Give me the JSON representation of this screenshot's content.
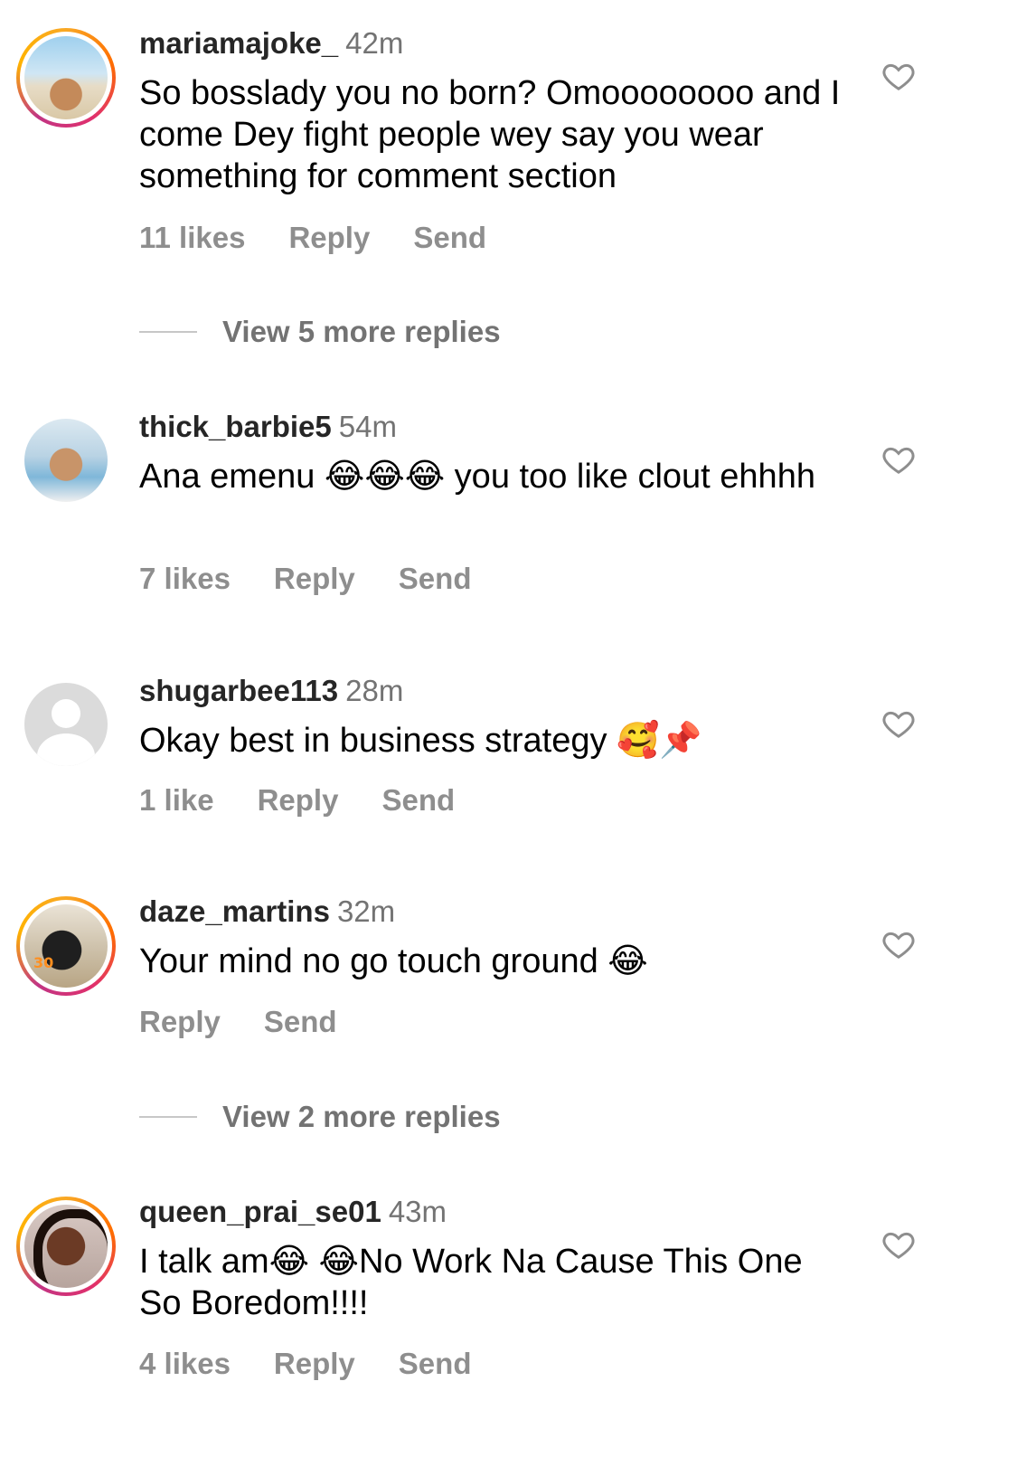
{
  "comments": [
    {
      "username": "mariamajoke_",
      "time": "42m",
      "text": "So bosslady you no born? Omoooooooo and I come Dey fight people wey say you wear something for comment section",
      "likes": "11 likes",
      "reply": "Reply",
      "send": "Send",
      "more_replies": "View 5 more replies",
      "avatar_story_ring": true
    },
    {
      "username": "thick_barbie5",
      "time": "54m",
      "text": "Ana emenu 😂😂😂 you too like clout ehhhh",
      "likes": "7 likes",
      "reply": "Reply",
      "send": "Send",
      "avatar_story_ring": false
    },
    {
      "username": "shugarbee113",
      "time": "28m",
      "text": "Okay best in business strategy 🥰📌",
      "likes": "1 like",
      "reply": "Reply",
      "send": "Send",
      "avatar_story_ring": false
    },
    {
      "username": "daze_martins",
      "time": "32m",
      "text": "Your mind no go touch ground 😂",
      "reply": "Reply",
      "send": "Send",
      "more_replies": "View 2 more replies",
      "avatar_story_ring": true,
      "avatar_jersey_number": "30"
    },
    {
      "username": "queen_prai_se01",
      "time": "43m",
      "text": "I talk am😂 😂No Work Na Cause This One So Boredom!!!!",
      "likes": "4 likes",
      "reply": "Reply",
      "send": "Send",
      "avatar_story_ring": true
    }
  ],
  "colors": {
    "username": "#262626",
    "meta": "#8e8e8e",
    "divider": "#c7c7c7",
    "story_ring": "#e1306c"
  },
  "icons": {
    "like": "heart-outline-icon",
    "default_avatar": "default-profile-icon"
  }
}
